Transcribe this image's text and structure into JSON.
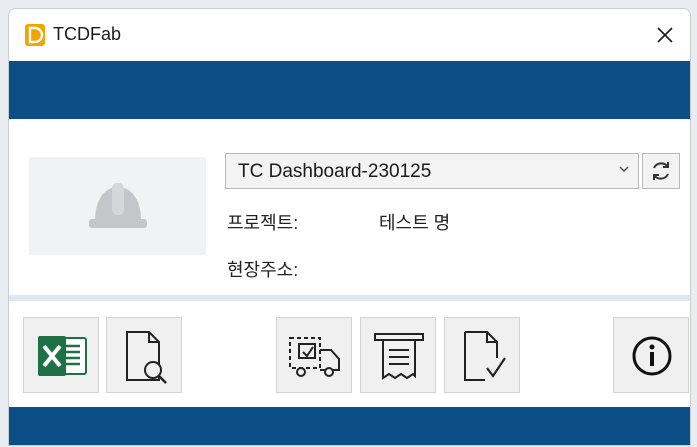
{
  "window": {
    "title": "TCDFab"
  },
  "project": {
    "selected": "TC Dashboard-230125",
    "project_label": "프로젝트:",
    "project_value": "테스트 명",
    "address_label": "현장주소:",
    "address_value": ""
  },
  "toolbar": {
    "icons": [
      "excel-icon",
      "document-search-icon",
      "delivery-truck-icon",
      "receipt-icon",
      "document-check-icon",
      "info-icon"
    ]
  },
  "colors": {
    "accent": "#0b4f86",
    "excel": "#1e7145",
    "app_icon": "#f0a500",
    "divider": "#dce8f3"
  }
}
